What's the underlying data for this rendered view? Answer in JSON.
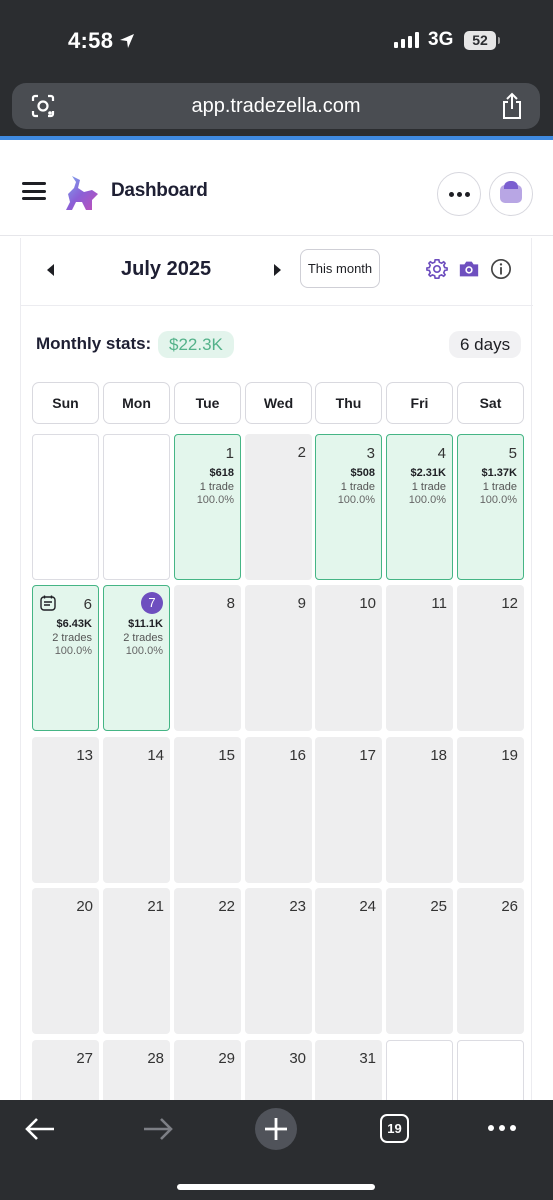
{
  "status_bar": {
    "time": "4:58",
    "network": "3G",
    "battery": "52"
  },
  "browser": {
    "url": "app.tradezella.com",
    "tab_count": "19"
  },
  "header": {
    "title": "Dashboard"
  },
  "calendar": {
    "month_label": "July 2025",
    "this_month_label": "This month",
    "stats_label": "Monthly stats:",
    "stats_value": "$22.3K",
    "days_count": "6 days",
    "weekdays": [
      "Sun",
      "Mon",
      "Tue",
      "Wed",
      "Thu",
      "Fri",
      "Sat"
    ],
    "days": [
      {
        "day": "1",
        "pnl": "$618",
        "trades": "1 trade",
        "win": "100.0%"
      },
      {
        "day": "2"
      },
      {
        "day": "3",
        "pnl": "$508",
        "trades": "1 trade",
        "win": "100.0%"
      },
      {
        "day": "4",
        "pnl": "$2.31K",
        "trades": "1 trade",
        "win": "100.0%"
      },
      {
        "day": "5",
        "pnl": "$1.37K",
        "trades": "1 trade",
        "win": "100.0%"
      },
      {
        "day": "6",
        "pnl": "$6.43K",
        "trades": "2 trades",
        "win": "100.0%"
      },
      {
        "day": "7",
        "pnl": "$11.1K",
        "trades": "2 trades",
        "win": "100.0%"
      },
      {
        "day": "8"
      },
      {
        "day": "9"
      },
      {
        "day": "10"
      },
      {
        "day": "11"
      },
      {
        "day": "12"
      },
      {
        "day": "13"
      },
      {
        "day": "14"
      },
      {
        "day": "15"
      },
      {
        "day": "16"
      },
      {
        "day": "17"
      },
      {
        "day": "18"
      },
      {
        "day": "19"
      },
      {
        "day": "20"
      },
      {
        "day": "21"
      },
      {
        "day": "22"
      },
      {
        "day": "23"
      },
      {
        "day": "24"
      },
      {
        "day": "25"
      },
      {
        "day": "26"
      },
      {
        "day": "27"
      },
      {
        "day": "28"
      },
      {
        "day": "29"
      },
      {
        "day": "30"
      },
      {
        "day": "31"
      }
    ]
  },
  "colors": {
    "accent": "#6e4fbf",
    "win_bg": "#e3f6ec",
    "win_border": "#45b585",
    "stat_green": "#54b28a"
  },
  "icons": {
    "status": [
      "location-arrow-icon",
      "signal-icon",
      "battery-icon"
    ],
    "browser": [
      "lens-icon",
      "share-icon",
      "back-arrow-icon",
      "forward-arrow-icon",
      "plus-icon",
      "tabs-icon",
      "more-icon"
    ],
    "app": [
      "menu-icon",
      "logo-icon",
      "more-icon",
      "avatar-icon",
      "caret-left-icon",
      "caret-right-icon",
      "gear-icon",
      "camera-icon",
      "info-icon",
      "journal-note-icon"
    ]
  }
}
